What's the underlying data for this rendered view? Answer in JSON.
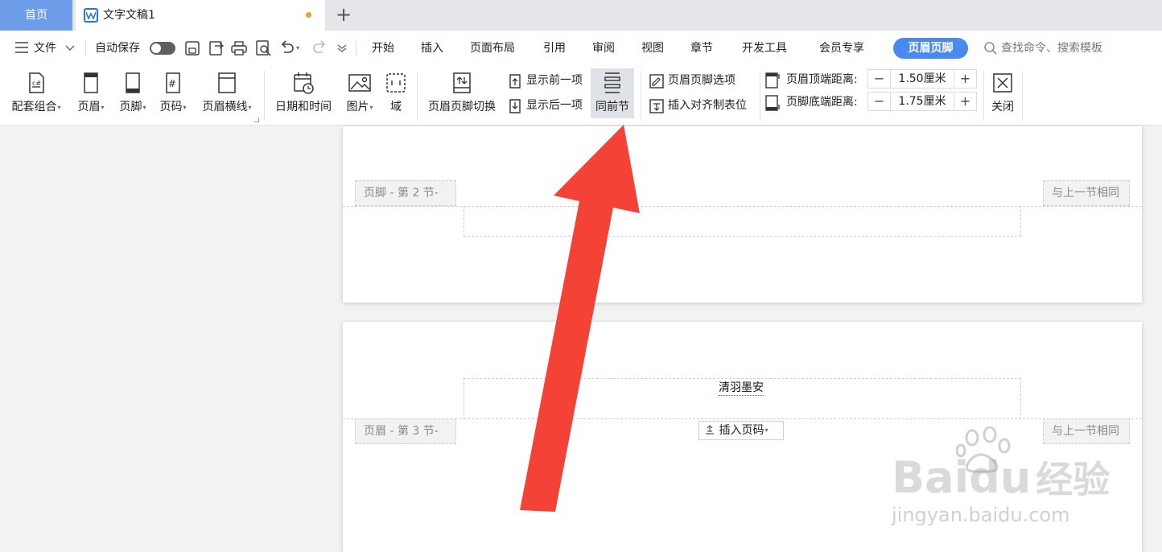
{
  "tabs": {
    "home": "首页",
    "document": "文字文稿1",
    "new_tab_icon": "plus-icon"
  },
  "menu": {
    "file": "文件",
    "autosave": "自动保存",
    "items": [
      "开始",
      "插入",
      "页面布局",
      "引用",
      "审阅",
      "视图",
      "章节",
      "开发工具",
      "会员专享"
    ],
    "active": "页眉页脚",
    "search_placeholder": "查找命令、搜索模板"
  },
  "ribbon": {
    "template_set": "配套组合",
    "header": "页眉",
    "footer": "页脚",
    "page_number": "页码",
    "header_line": "页眉横线",
    "date_time": "日期和时间",
    "picture": "图片",
    "field": "域",
    "header_footer_switch": "页眉页脚切换",
    "show_previous": "显示前一项",
    "show_next": "显示后一项",
    "same_as_previous": "同前节",
    "header_footer_options": "页眉页脚选项",
    "insert_align_tab": "插入对齐制表位",
    "header_top_distance_label": "页眉顶端距离:",
    "header_top_distance_value": "1.50厘米",
    "footer_bottom_distance_label": "页脚底端距离:",
    "footer_bottom_distance_value": "1.75厘米",
    "close": "关闭"
  },
  "document": {
    "page1_footer_tag": "页脚  - 第 2 节-",
    "page1_same_tag": "与上一节相同",
    "page2_header_tag": "页眉  - 第 3 节-",
    "page2_same_tag": "与上一节相同",
    "header_text": "清羽墨安",
    "insert_page_number": "插入页码"
  },
  "watermark": {
    "logo": "Bai",
    "logo_du": "du",
    "logo_cn": "经验",
    "url": "jingyan.baidu.com"
  },
  "colors": {
    "accent": "#4a8af0",
    "home_tab": "#6d9ce8",
    "arrow": "#f44336",
    "modified_dot": "#e9a23b"
  }
}
